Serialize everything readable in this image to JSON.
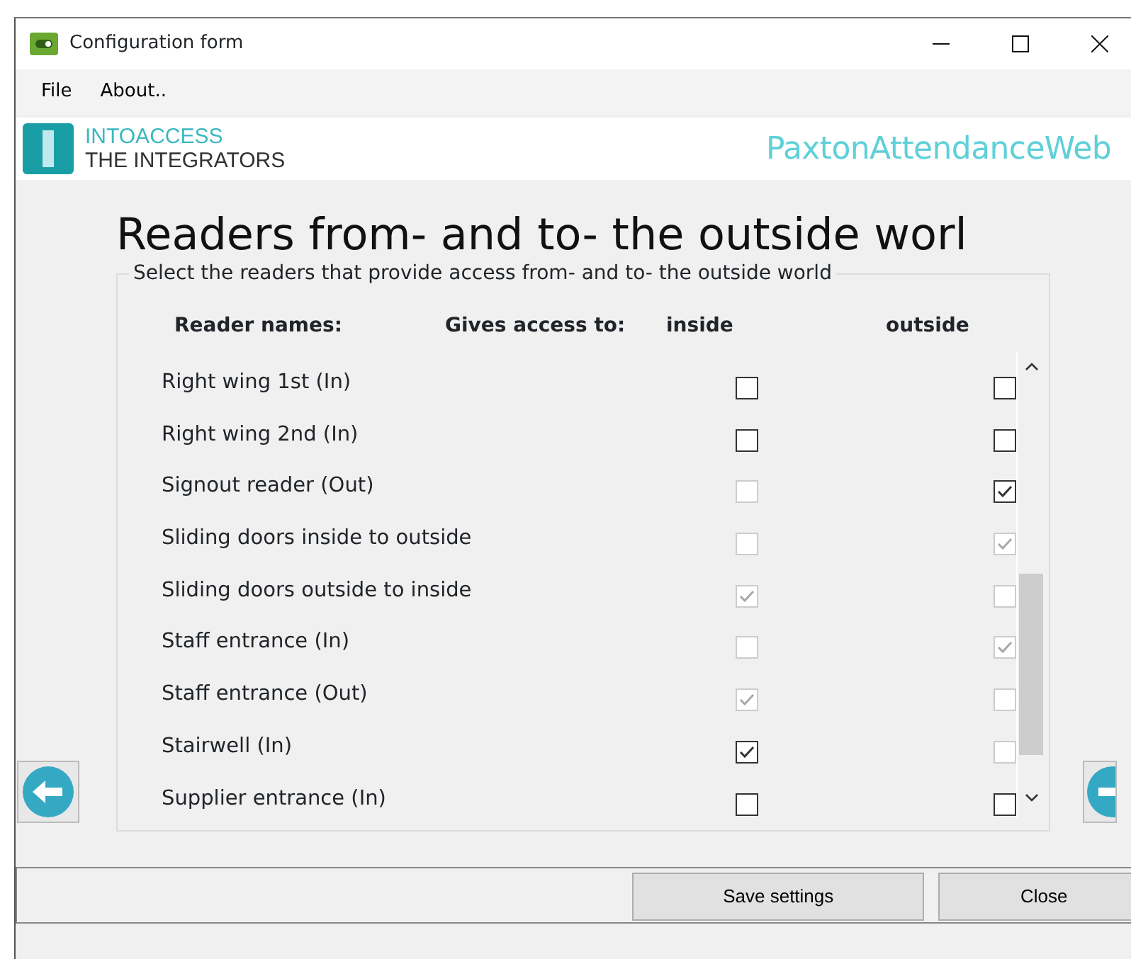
{
  "window": {
    "title": "Configuration form"
  },
  "menu": [
    "File",
    "About.."
  ],
  "brand": {
    "line_1": "INTOACCESS",
    "line_2": "THE INTEGRATORS",
    "product": "PaxtonAttendanceWeb"
  },
  "heading": "Readers from- and to- the outside worl",
  "group": {
    "legend": "Select the readers that provide access from- and to- the outside world",
    "columns": [
      "Reader names:",
      "Gives access to:",
      "inside",
      "outside"
    ],
    "rows": [
      {
        "name": "Right wing 1st (In)",
        "inside": {
          "checked": false,
          "disabled": false
        },
        "outside": {
          "checked": false,
          "disabled": false
        }
      },
      {
        "name": "Right wing 2nd (In)",
        "inside": {
          "checked": false,
          "disabled": false
        },
        "outside": {
          "checked": false,
          "disabled": false
        }
      },
      {
        "name": "Signout reader (Out)",
        "inside": {
          "checked": false,
          "disabled": true
        },
        "outside": {
          "checked": true,
          "disabled": false
        }
      },
      {
        "name": "Sliding doors inside to outside",
        "inside": {
          "checked": false,
          "disabled": true
        },
        "outside": {
          "checked": true,
          "disabled": true
        }
      },
      {
        "name": "Sliding doors outside to inside",
        "inside": {
          "checked": true,
          "disabled": true
        },
        "outside": {
          "checked": false,
          "disabled": true
        }
      },
      {
        "name": "Staff entrance (In)",
        "inside": {
          "checked": false,
          "disabled": true
        },
        "outside": {
          "checked": true,
          "disabled": true
        }
      },
      {
        "name": "Staff entrance (Out)",
        "inside": {
          "checked": true,
          "disabled": true
        },
        "outside": {
          "checked": false,
          "disabled": true
        }
      },
      {
        "name": "Stairwell (In)",
        "inside": {
          "checked": true,
          "disabled": false
        },
        "outside": {
          "checked": false,
          "disabled": true
        }
      },
      {
        "name": "Supplier entrance (In)",
        "inside": {
          "checked": false,
          "disabled": false
        },
        "outside": {
          "checked": false,
          "disabled": false
        }
      }
    ]
  },
  "buttons": [
    "Save settings",
    "Close"
  ]
}
